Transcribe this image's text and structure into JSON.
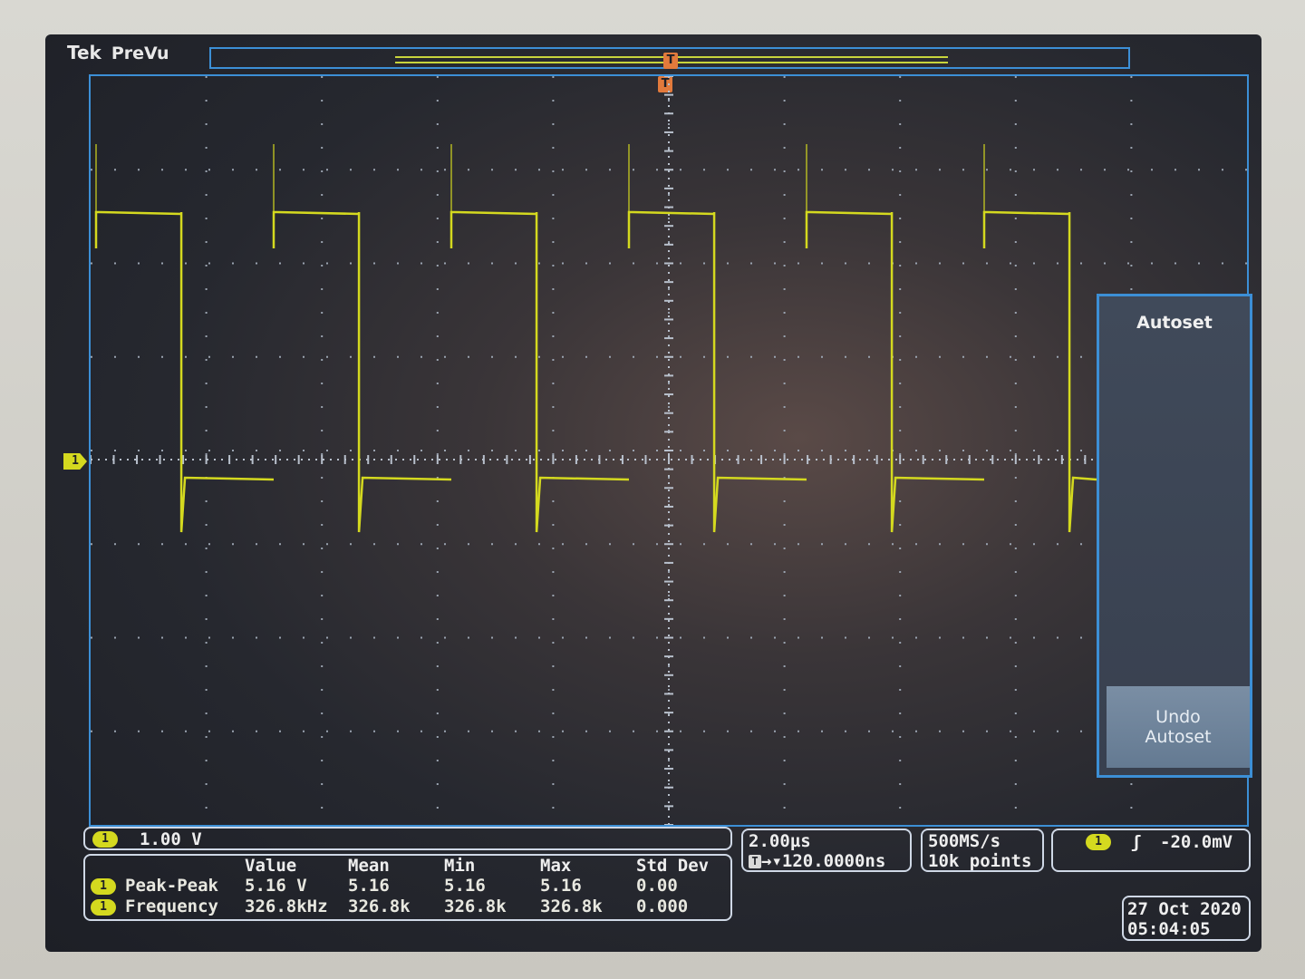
{
  "brand": {
    "logo": "Tek",
    "mode": "PreVu"
  },
  "trigger_marker_label": "T",
  "channel": {
    "marker_label": "1",
    "color": "#d4d91f",
    "scale": "1.00 V"
  },
  "side_menu": {
    "title": "Autoset",
    "undo_label": "Undo\nAutoset"
  },
  "measurements": {
    "headers": [
      "Value",
      "Mean",
      "Min",
      "Max",
      "Std Dev"
    ],
    "rows": [
      {
        "badge": "1",
        "name": "Peak-Peak",
        "cells": [
          "5.16 V",
          "5.16",
          "5.16",
          "5.16",
          "0.00"
        ]
      },
      {
        "badge": "1",
        "name": "Frequency",
        "cells": [
          "326.8kHz",
          "326.8k",
          "326.8k",
          "326.8k",
          "0.000"
        ]
      }
    ]
  },
  "timebase": {
    "scale": "2.00µs",
    "trig_badge": "T",
    "position": "→▾120.0000ns"
  },
  "acquisition": {
    "rate": "500MS/s",
    "points": "10k points"
  },
  "trigger": {
    "badge": "1",
    "slope_icon": "rising-edge-icon",
    "level": "-20.0mV"
  },
  "datetime": {
    "date": "27 Oct  2020",
    "time": "05:04:05"
  },
  "colors": {
    "grid_border": "#3c8fd6",
    "trace": "#d4d91f",
    "trigger_marker": "#e27a3c"
  },
  "waveform": {
    "type": "square-wave",
    "frequency_khz": 326.8,
    "peak_peak_v": 5.16
  }
}
